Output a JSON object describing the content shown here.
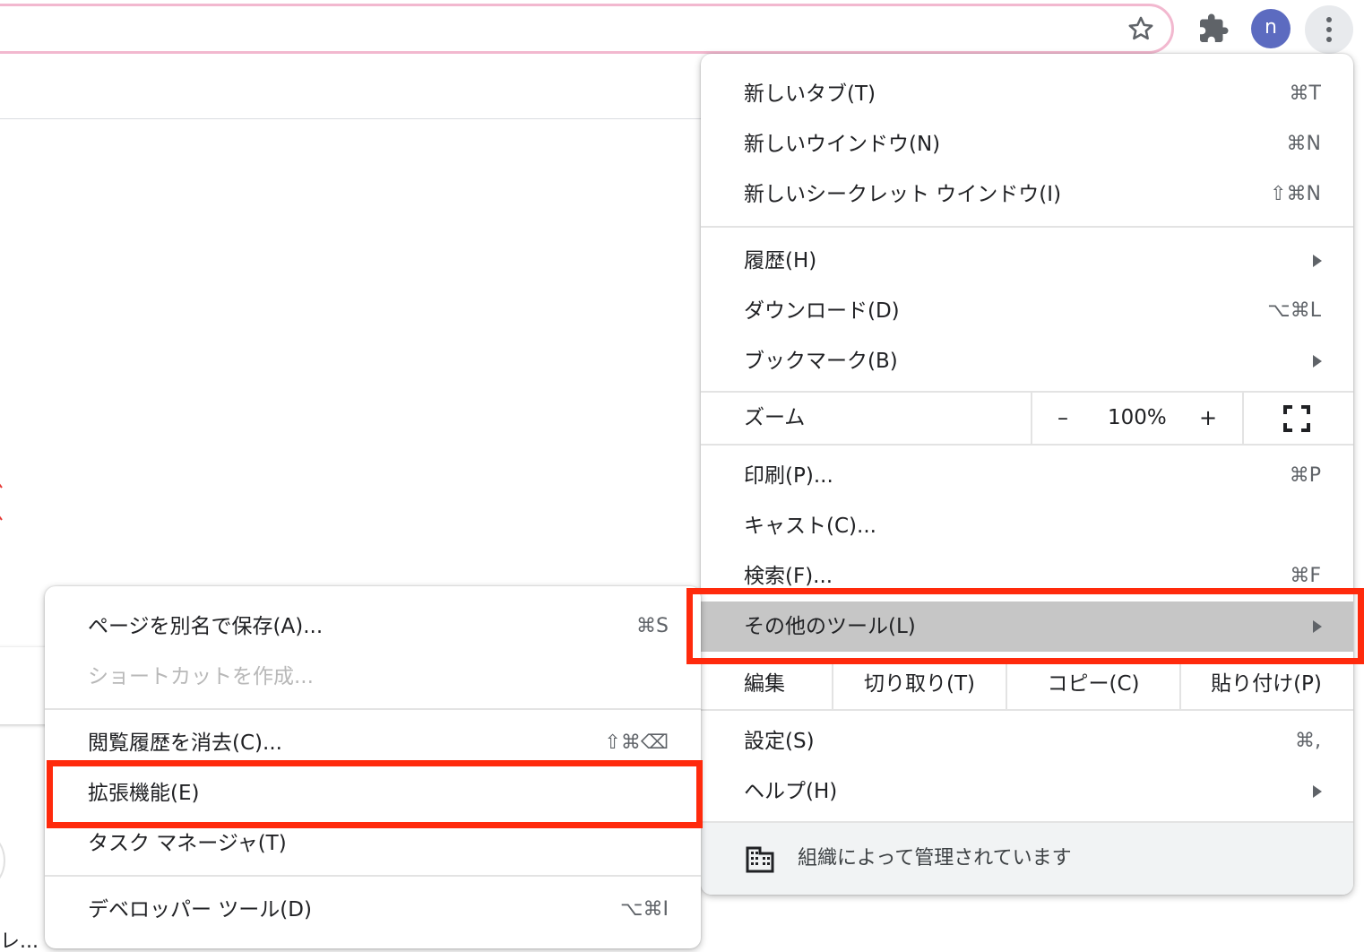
{
  "toolbar": {
    "avatar_letter": "n",
    "icons": [
      "star-icon",
      "puzzle-icon",
      "kebab-menu-icon"
    ]
  },
  "page": {
    "truncated_text": "レ..."
  },
  "menu": {
    "new_tab": {
      "label": "新しいタブ(T)",
      "shortcut": "⌘T"
    },
    "new_window": {
      "label": "新しいウインドウ(N)",
      "shortcut": "⌘N"
    },
    "new_incognito": {
      "label": "新しいシークレット ウインドウ(I)",
      "shortcut": "⇧⌘N"
    },
    "history": {
      "label": "履歴(H)"
    },
    "downloads": {
      "label": "ダウンロード(D)",
      "shortcut": "⌥⌘L"
    },
    "bookmarks": {
      "label": "ブックマーク(B)"
    },
    "zoom": {
      "label": "ズーム",
      "minus": "–",
      "value": "100%",
      "plus": "+"
    },
    "print": {
      "label": "印刷(P)...",
      "shortcut": "⌘P"
    },
    "cast": {
      "label": "キャスト(C)..."
    },
    "find": {
      "label": "検索(F)...",
      "shortcut": "⌘F"
    },
    "more_tools": {
      "label": "その他のツール(L)"
    },
    "edit": {
      "label": "編集",
      "cut": "切り取り(T)",
      "copy": "コピー(C)",
      "paste": "貼り付け(P)"
    },
    "settings": {
      "label": "設定(S)",
      "shortcut": "⌘,"
    },
    "help": {
      "label": "ヘルプ(H)"
    },
    "managed": {
      "label": "組織によって管理されています"
    }
  },
  "submenu": {
    "save_page": {
      "label": "ページを別名で保存(A)...",
      "shortcut": "⌘S"
    },
    "create_shortcut": {
      "label": "ショートカットを作成..."
    },
    "clear_browsing": {
      "label": "閲覧履歴を消去(C)...",
      "shortcut": "⇧⌘⌫"
    },
    "extensions": {
      "label": "拡張機能(E)"
    },
    "task_manager": {
      "label": "タスク マネージャ(T)"
    },
    "developer_tools": {
      "label": "デベロッパー ツール(D)",
      "shortcut": "⌥⌘I"
    }
  },
  "colors": {
    "highlight_border": "#ff2a0c",
    "hover_bg": "#c6c6c6",
    "avatar_bg": "#5c6bc0",
    "omnibox_border": "#f2b8cf"
  }
}
